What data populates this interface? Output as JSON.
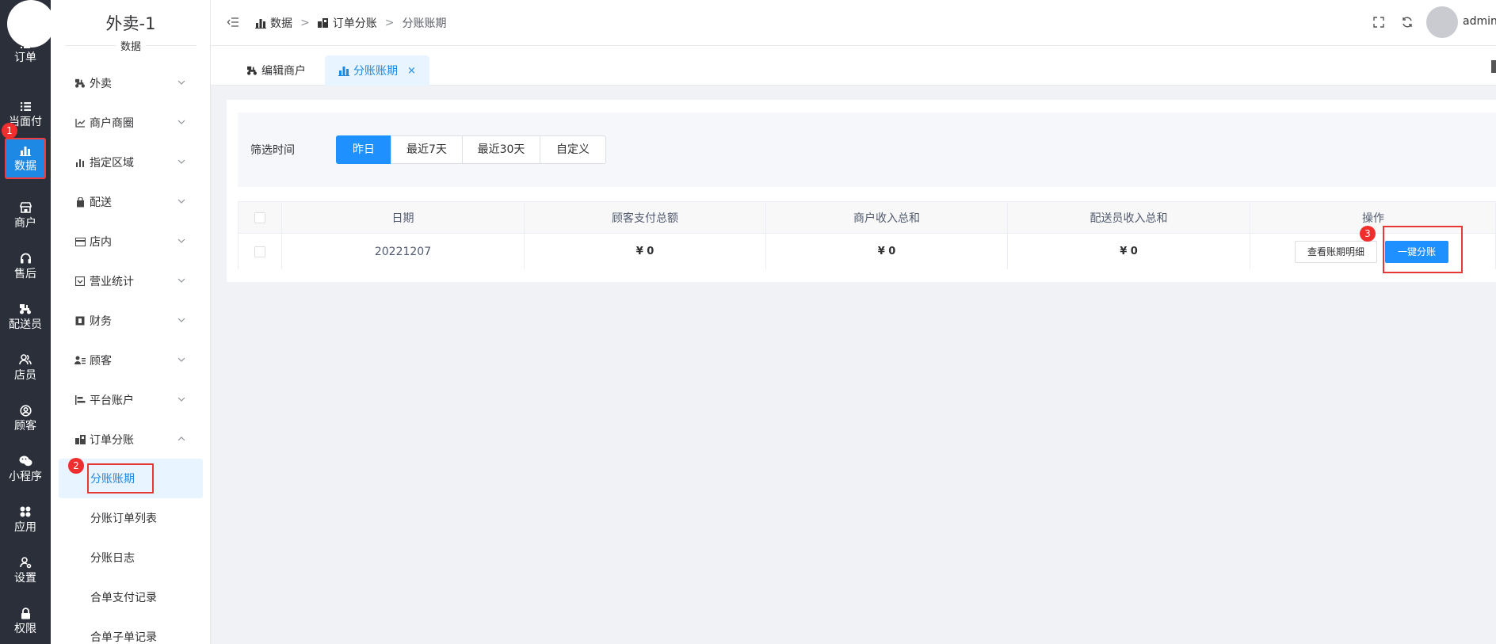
{
  "rail": {
    "items": [
      {
        "label": "订单",
        "icon": "list-icon"
      },
      {
        "label": "当面付",
        "icon": "list-icon"
      },
      {
        "label": "数据",
        "icon": "bar-chart-icon"
      },
      {
        "label": "商户",
        "icon": "shop-icon"
      },
      {
        "label": "售后",
        "icon": "headset-icon"
      },
      {
        "label": "配送员",
        "icon": "scooter-icon"
      },
      {
        "label": "店员",
        "icon": "users-icon"
      },
      {
        "label": "顾客",
        "icon": "user-circle-icon"
      },
      {
        "label": "小程序",
        "icon": "wechat-icon"
      },
      {
        "label": "应用",
        "icon": "apps-icon"
      },
      {
        "label": "设置",
        "icon": "user-gear-icon"
      },
      {
        "label": "权限",
        "icon": "lock-icon"
      }
    ],
    "active_index": 2
  },
  "steps": [
    "1",
    "2",
    "3"
  ],
  "sidebar": {
    "title": "外卖-1",
    "subtitle": "数据",
    "menu": [
      {
        "label": "外卖",
        "icon": "scooter-icon"
      },
      {
        "label": "商户商圈",
        "icon": "line-chart-icon"
      },
      {
        "label": "指定区域",
        "icon": "bar-chart-icon"
      },
      {
        "label": "配送",
        "icon": "bag-icon"
      },
      {
        "label": "店内",
        "icon": "card-icon"
      },
      {
        "label": "营业统计",
        "icon": "archive-icon"
      },
      {
        "label": "财务",
        "icon": "finance-icon"
      },
      {
        "label": "顾客",
        "icon": "user-list-icon"
      },
      {
        "label": "平台账户",
        "icon": "align-icon"
      },
      {
        "label": "订单分账",
        "icon": "split-icon"
      }
    ],
    "submenu": [
      {
        "label": "分账账期"
      },
      {
        "label": "分账订单列表"
      },
      {
        "label": "分账日志"
      },
      {
        "label": "合单支付记录"
      },
      {
        "label": "合单子单记录"
      }
    ]
  },
  "header": {
    "breadcrumb": [
      "数据",
      "订单分账",
      "分账账期"
    ],
    "breadcrumb_sep": ">",
    "username": "admin"
  },
  "tabs": [
    {
      "label": "编辑商户"
    },
    {
      "label": "分账账期",
      "close": "×"
    }
  ],
  "filter": {
    "label": "筛选时间",
    "options": [
      "昨日",
      "最近7天",
      "最近30天",
      "自定义"
    ],
    "active_index": 0
  },
  "table": {
    "columns": [
      "日期",
      "顾客支付总额",
      "商户收入总和",
      "配送员收入总和",
      "操作"
    ],
    "rows": [
      {
        "date": "20221207",
        "customer_total": "¥ 0",
        "merchant_total": "¥ 0",
        "courier_total": "¥ 0"
      }
    ],
    "actions": {
      "detail": "查看账期明细",
      "split": "一键分账"
    }
  },
  "colors": {
    "rail_bg": "#2b2f3a",
    "accent": "#1e90ff",
    "highlight": "#e53935"
  }
}
